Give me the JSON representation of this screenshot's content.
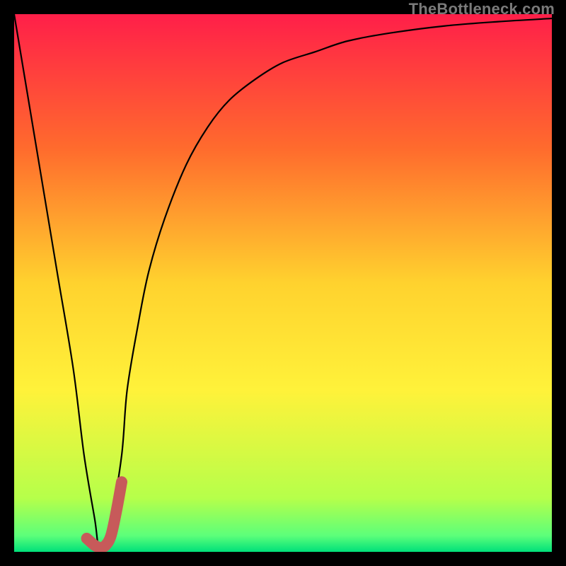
{
  "watermark": {
    "text": "TheBottleneck.com"
  },
  "chart_data": {
    "type": "line",
    "title": "",
    "xlabel": "",
    "ylabel": "",
    "xlim": [
      0,
      100
    ],
    "ylim": [
      0,
      100
    ],
    "grid": false,
    "legend": false,
    "background_gradient": {
      "stops": [
        {
          "offset": 0.0,
          "color": "#ff1f49"
        },
        {
          "offset": 0.25,
          "color": "#ff6b2d"
        },
        {
          "offset": 0.5,
          "color": "#ffd22e"
        },
        {
          "offset": 0.7,
          "color": "#fff23a"
        },
        {
          "offset": 0.9,
          "color": "#b6ff4a"
        },
        {
          "offset": 0.97,
          "color": "#5cff7a"
        },
        {
          "offset": 1.0,
          "color": "#00e07a"
        }
      ]
    },
    "series": [
      {
        "name": "bottleneck-curve",
        "stroke": "#000000",
        "stroke_width": 2.2,
        "x": [
          0,
          2,
          5,
          8,
          11,
          13,
          15,
          16,
          18,
          20,
          21,
          23,
          25,
          28,
          32,
          36,
          40,
          45,
          50,
          56,
          62,
          70,
          80,
          90,
          100
        ],
        "y": [
          100,
          88,
          70,
          52,
          34,
          18,
          6,
          0,
          6,
          18,
          30,
          42,
          52,
          62,
          72,
          79,
          84,
          88,
          91,
          93,
          95,
          96.5,
          97.8,
          98.6,
          99.2
        ]
      },
      {
        "name": "highlight-j",
        "stroke": "#c75a5a",
        "stroke_width": 16,
        "linecap": "round",
        "x": [
          13.5,
          15,
          16,
          17,
          18,
          19,
          20
        ],
        "y": [
          2.5,
          1.2,
          0.8,
          1.2,
          3.0,
          7.5,
          13
        ]
      }
    ]
  }
}
